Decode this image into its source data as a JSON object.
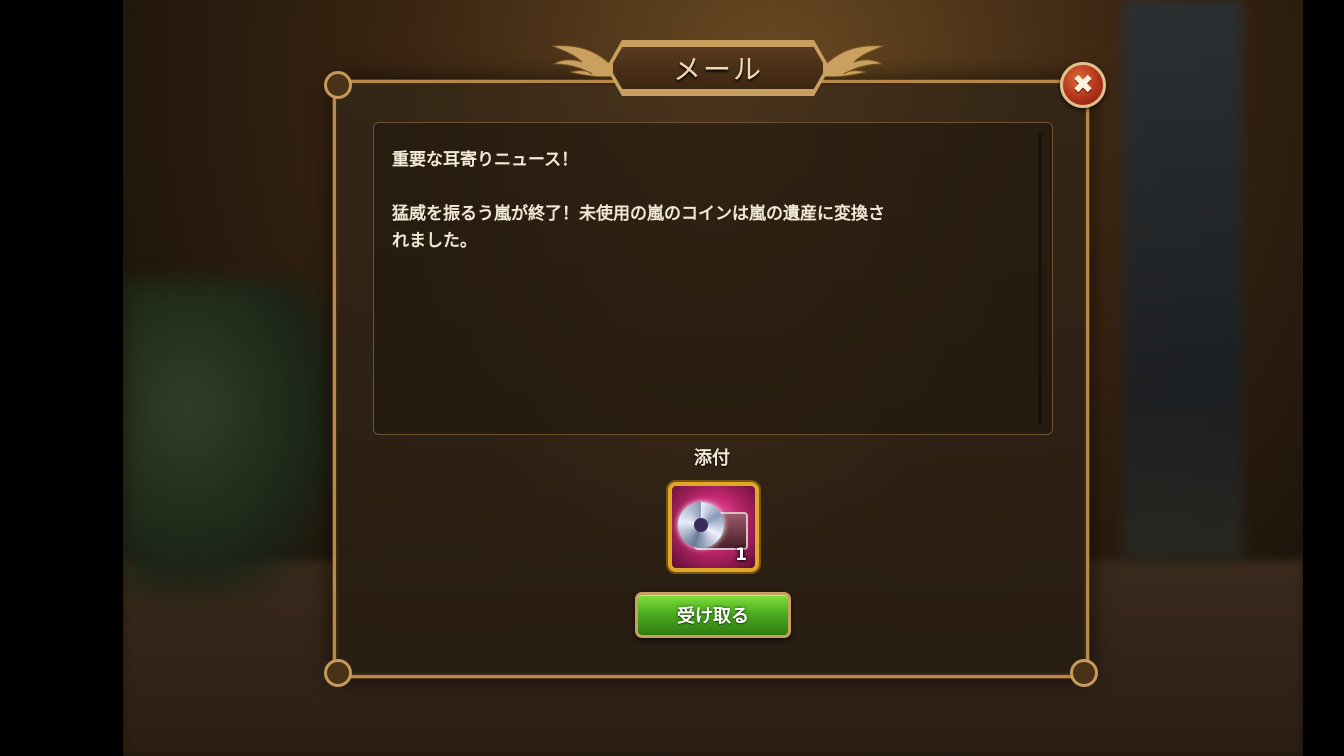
{
  "dialog": {
    "title": "メール",
    "close_icon": "close-icon",
    "message": {
      "heading": "重要な耳寄りニュース！",
      "body_line1": "猛威を振るう嵐が終了！未使用の嵐のコインは嵐の遺産に変換さ",
      "body_line2": "れました。"
    },
    "attachment": {
      "label": "添付",
      "item_icon": "storm-chest-icon",
      "count": "1"
    },
    "receive_button": "受け取る"
  },
  "colors": {
    "frame_gold": "#b7884a",
    "button_green": "#4aa820",
    "close_red": "#b0341a",
    "item_pink": "#c0266e"
  }
}
